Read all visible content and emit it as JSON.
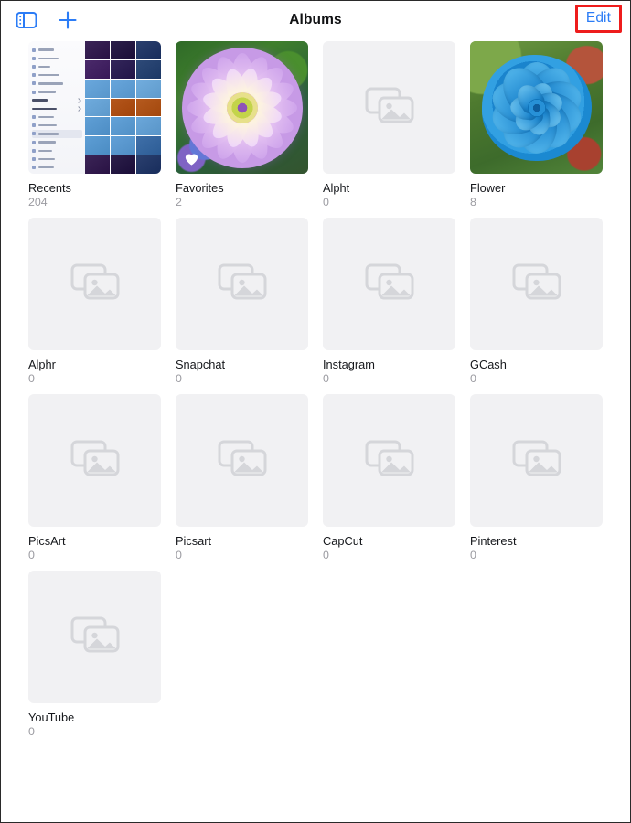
{
  "window": {
    "title": "Albums"
  },
  "topbar": {
    "sidebar_icon": "sidebar-toggle-icon",
    "add_icon": "plus-icon",
    "title": "Albums",
    "edit_label": "Edit",
    "edit_highlight_color": "#ee1c1c",
    "accent_color": "#2b7cf6"
  },
  "grid": {
    "placeholder_icon": "photo-stack-icon",
    "favorite_badge_icon": "heart-icon",
    "albums": [
      {
        "name": "Recents",
        "count": "204",
        "thumb": "photos-grid-screenshot",
        "favorite_badge": false
      },
      {
        "name": "Favorites",
        "count": "2",
        "thumb": "purple-dahlia-photo",
        "favorite_badge": true
      },
      {
        "name": "Alpht",
        "count": "0",
        "thumb": "placeholder",
        "favorite_badge": false
      },
      {
        "name": "Flower",
        "count": "8",
        "thumb": "blue-rose-photo",
        "favorite_badge": false
      },
      {
        "name": "Alphr",
        "count": "0",
        "thumb": "placeholder",
        "favorite_badge": false
      },
      {
        "name": "Snapchat",
        "count": "0",
        "thumb": "placeholder",
        "favorite_badge": false
      },
      {
        "name": "Instagram",
        "count": "0",
        "thumb": "placeholder",
        "favorite_badge": false
      },
      {
        "name": "GCash",
        "count": "0",
        "thumb": "placeholder",
        "favorite_badge": false
      },
      {
        "name": "PicsArt",
        "count": "0",
        "thumb": "placeholder",
        "favorite_badge": false
      },
      {
        "name": "Picsart",
        "count": "0",
        "thumb": "placeholder",
        "favorite_badge": false
      },
      {
        "name": "CapCut",
        "count": "0",
        "thumb": "placeholder",
        "favorite_badge": false
      },
      {
        "name": "Pinterest",
        "count": "0",
        "thumb": "placeholder",
        "favorite_badge": false
      },
      {
        "name": "YouTube",
        "count": "0",
        "thumb": "placeholder",
        "favorite_badge": false
      }
    ]
  }
}
